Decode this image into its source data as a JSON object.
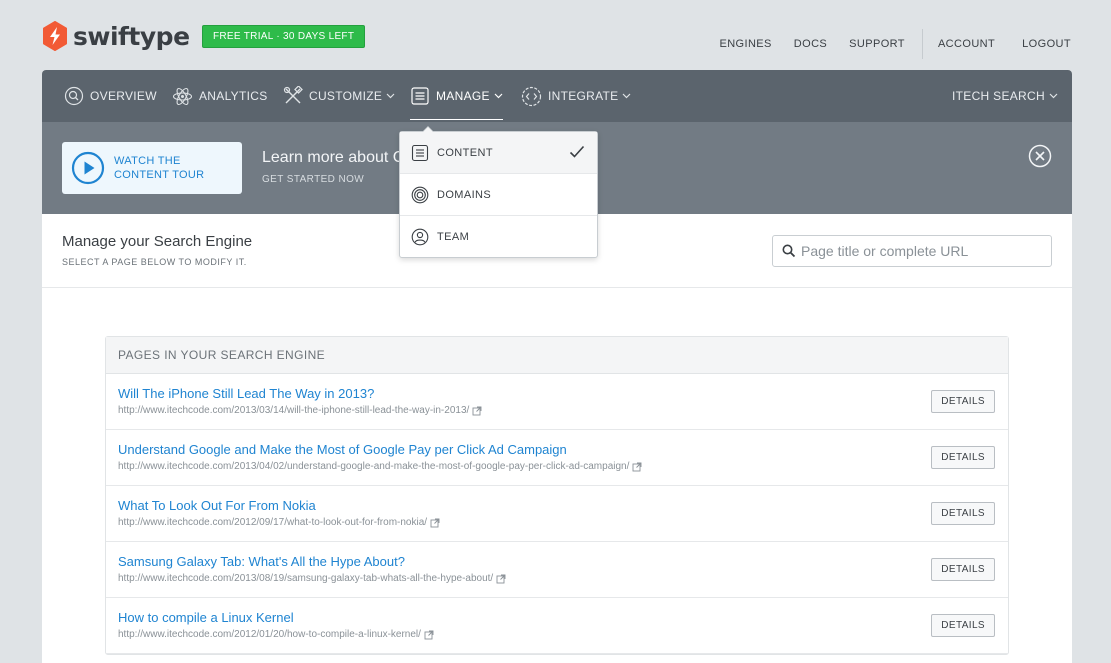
{
  "brand": {
    "name": "swiftype",
    "trial_badge": "FREE TRIAL · 30 DAYS LEFT",
    "accent": "#f25a35"
  },
  "top_links": {
    "engines": "ENGINES",
    "docs": "DOCS",
    "support": "SUPPORT",
    "account": "ACCOUNT",
    "logout": "LOGOUT"
  },
  "nav": {
    "overview": "OVERVIEW",
    "analytics": "ANALYTICS",
    "customize": "CUSTOMIZE",
    "manage": "MANAGE",
    "integrate": "INTEGRATE",
    "engine": "ITECH SEARCH"
  },
  "tour": {
    "button": "WATCH THE CONTENT TOUR",
    "title": "Learn more about C",
    "subtitle": "GET STARTED NOW"
  },
  "manage_dropdown": {
    "items": [
      {
        "label": "CONTENT",
        "icon": "content-icon",
        "selected": true
      },
      {
        "label": "DOMAINS",
        "icon": "domains-icon",
        "selected": false
      },
      {
        "label": "TEAM",
        "icon": "team-icon",
        "selected": false
      }
    ]
  },
  "manage": {
    "title": "Manage your Search Engine",
    "subtitle": "SELECT A PAGE BELOW TO MODIFY IT.",
    "search_placeholder": "Page title or complete URL"
  },
  "pages": {
    "header": "PAGES IN YOUR SEARCH ENGINE",
    "details_label": "DETAILS",
    "rows": [
      {
        "title": "Will The iPhone Still Lead The Way in 2013?",
        "url": "http://www.itechcode.com/2013/03/14/will-the-iphone-still-lead-the-way-in-2013/"
      },
      {
        "title": "Understand Google and Make the Most of Google Pay per Click Ad Campaign",
        "url": "http://www.itechcode.com/2013/04/02/understand-google-and-make-the-most-of-google-pay-per-click-ad-campaign/"
      },
      {
        "title": "What To Look Out For From Nokia",
        "url": "http://www.itechcode.com/2012/09/17/what-to-look-out-for-from-nokia/"
      },
      {
        "title": "Samsung Galaxy Tab: What's All the Hype About?",
        "url": "http://www.itechcode.com/2013/08/19/samsung-galaxy-tab-whats-all-the-hype-about/"
      },
      {
        "title": "How to compile a Linux Kernel",
        "url": "http://www.itechcode.com/2012/01/20/how-to-compile-a-linux-kernel/"
      }
    ]
  }
}
